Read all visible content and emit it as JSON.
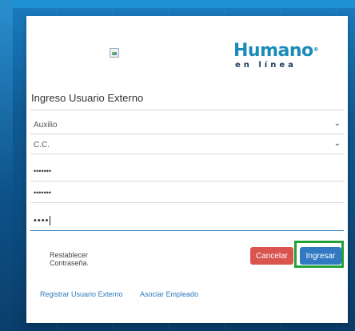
{
  "brand": {
    "name": "Humano",
    "reg": "®",
    "tagline": "en línea"
  },
  "form": {
    "title": "Ingreso Usuario Externo",
    "selects": [
      {
        "value": "Auxilio"
      },
      {
        "value": "C.C."
      }
    ],
    "fields": [
      {
        "value": "•••••••"
      },
      {
        "value": "•••••••"
      },
      {
        "value": "••••"
      }
    ],
    "reset_label": "Restablecer Contraseña.",
    "cancel_label": "Cancelar",
    "login_label": "Ingresar",
    "links": [
      {
        "label": "Registrar Usuario Externo"
      },
      {
        "label": "Asociar Empleado"
      }
    ]
  },
  "colors": {
    "accent": "#3179c2",
    "cancel": "#d9534f",
    "highlight": "#21a338",
    "brand": "#1a8bb8"
  },
  "icons": {
    "select_chevron": "chevron-down-icon",
    "broken_image": "broken-image-icon"
  }
}
